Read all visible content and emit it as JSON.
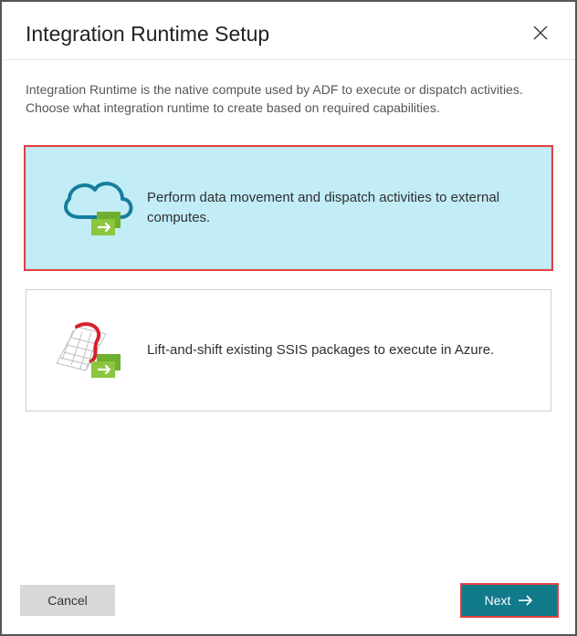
{
  "header": {
    "title": "Integration Runtime Setup"
  },
  "description": "Integration Runtime is the native compute used by ADF to execute or dispatch activities. Choose what integration runtime to create based on required capabilities.",
  "options": [
    {
      "id": "data-movement",
      "selected": true,
      "text": "Perform data movement and dispatch activities to external computes."
    },
    {
      "id": "ssis",
      "selected": false,
      "text": "Lift-and-shift existing SSIS packages to execute in Azure."
    }
  ],
  "footer": {
    "cancel_label": "Cancel",
    "next_label": "Next"
  }
}
